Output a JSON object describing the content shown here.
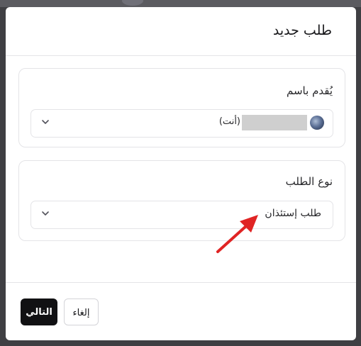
{
  "dialog": {
    "title": "طلب جديد"
  },
  "applicant_section": {
    "label": "يُقدم باسم",
    "selected_suffix": "(أنت)"
  },
  "request_type_section": {
    "label": "نوع الطلب",
    "selected_value": "طلب إستئذان"
  },
  "footer": {
    "next_label": "التالي",
    "cancel_label": "إلغاء"
  },
  "annotation": {
    "arrow_color": "#e02424"
  },
  "icons": {
    "select_chevron": "chevron-down-icon",
    "user_avatar": "avatar"
  }
}
